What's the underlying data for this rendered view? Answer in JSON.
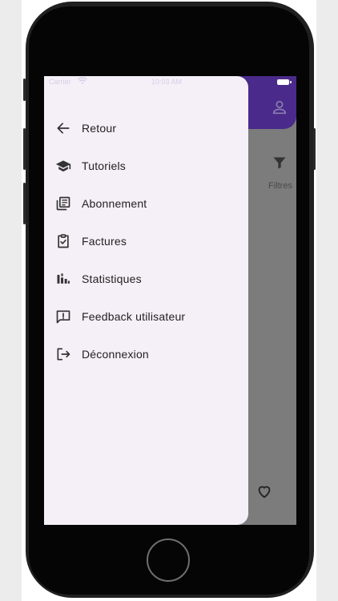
{
  "status_bar": {
    "carrier": "Carrier",
    "time": "10:03 AM"
  },
  "drawer": {
    "items": [
      {
        "label": "Retour",
        "icon": "arrow-back-icon"
      },
      {
        "label": "Tutoriels",
        "icon": "graduation-cap-icon"
      },
      {
        "label": "Abonnement",
        "icon": "library-books-icon"
      },
      {
        "label": "Factures",
        "icon": "clipboard-check-icon"
      },
      {
        "label": "Statistiques",
        "icon": "bar-chart-icon"
      },
      {
        "label": "Feedback utilisateur",
        "icon": "feedback-icon"
      },
      {
        "label": "Déconnexion",
        "icon": "logout-icon"
      }
    ]
  },
  "background_app": {
    "filter_label": "Filtres",
    "icons": [
      "person-icon",
      "filter-icon",
      "heart-icon"
    ]
  },
  "colors": {
    "header": "#4a2a8a",
    "drawer_background": "#f5eff7",
    "scrim": "#7c7c7c"
  }
}
